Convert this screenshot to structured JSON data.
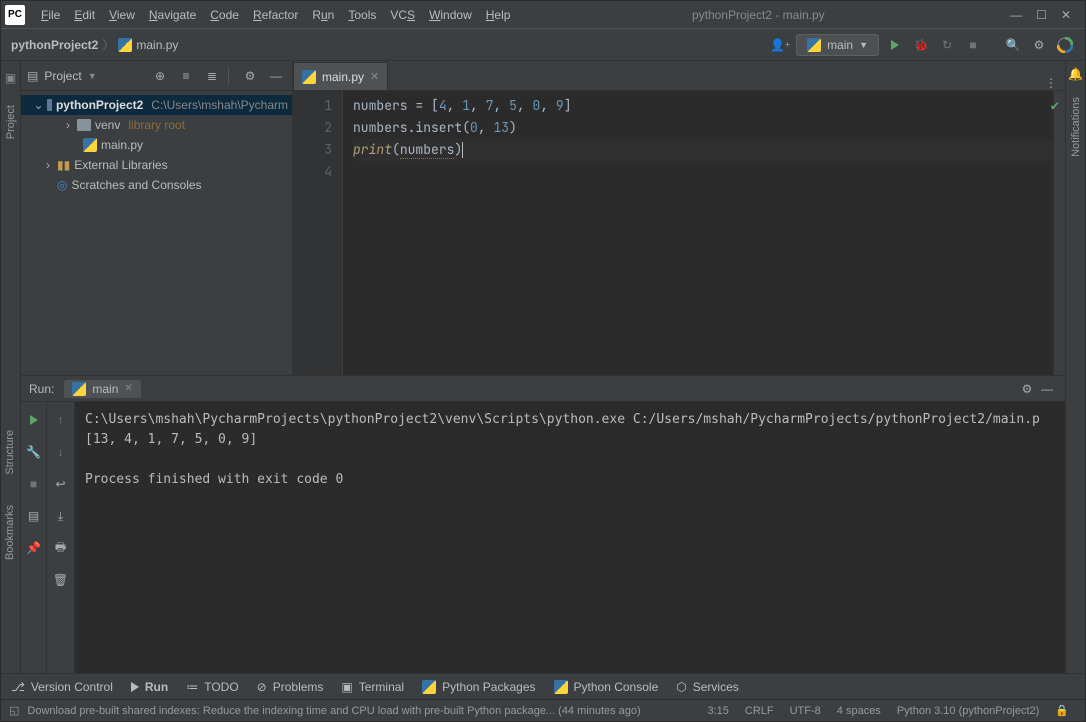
{
  "window": {
    "title": "pythonProject2 - main.py"
  },
  "menu": [
    "File",
    "Edit",
    "View",
    "Navigate",
    "Code",
    "Refactor",
    "Run",
    "Tools",
    "VCS",
    "Window",
    "Help"
  ],
  "breadcrumb": {
    "project": "pythonProject2",
    "file": "main.py"
  },
  "runConfig": {
    "name": "main"
  },
  "sidebar": {
    "title": "Project",
    "tree": {
      "root": {
        "name": "pythonProject2",
        "path": "C:\\Users\\mshah\\Pycharm"
      },
      "venv": {
        "name": "venv",
        "hint": "library root"
      },
      "mainpy": {
        "name": "main.py"
      },
      "extlib": {
        "name": "External Libraries"
      },
      "scratches": {
        "name": "Scratches and Consoles"
      }
    }
  },
  "leftTools": [
    "Project",
    "Structure",
    "Bookmarks"
  ],
  "rightTools": [
    "Notifications"
  ],
  "tab": {
    "name": "main.py"
  },
  "code": {
    "lines": [
      "1",
      "2",
      "3",
      "4"
    ],
    "l1": {
      "a": "numbers = [",
      "nums": [
        "4",
        "1",
        "7",
        "5",
        "0",
        "9"
      ],
      "b": "]"
    },
    "l2": {
      "a": "numbers.insert(",
      "n1": "0",
      "c": ", ",
      "n2": "13",
      "b": ")"
    },
    "l3": {
      "fn": "print",
      "a": "(",
      "arg": "numbers",
      "b": ")"
    }
  },
  "run": {
    "label": "Run:",
    "tab": "main",
    "out1": "C:\\Users\\mshah\\PycharmProjects\\pythonProject2\\venv\\Scripts\\python.exe C:/Users/mshah/PycharmProjects/pythonProject2/main.p",
    "out2": "[13, 4, 1, 7, 5, 0, 9]",
    "out3": "",
    "out4": "Process finished with exit code 0"
  },
  "bottom": {
    "vcs": "Version Control",
    "run": "Run",
    "todo": "TODO",
    "problems": "Problems",
    "terminal": "Terminal",
    "pypkg": "Python Packages",
    "pycon": "Python Console",
    "services": "Services"
  },
  "status": {
    "msg": "Download pre-built shared indexes: Reduce the indexing time and CPU load with pre-built Python package... (44 minutes ago)",
    "pos": "3:15",
    "crlf": "CRLF",
    "enc": "UTF-8",
    "indent": "4 spaces",
    "py": "Python 3.10 (pythonProject2)"
  }
}
